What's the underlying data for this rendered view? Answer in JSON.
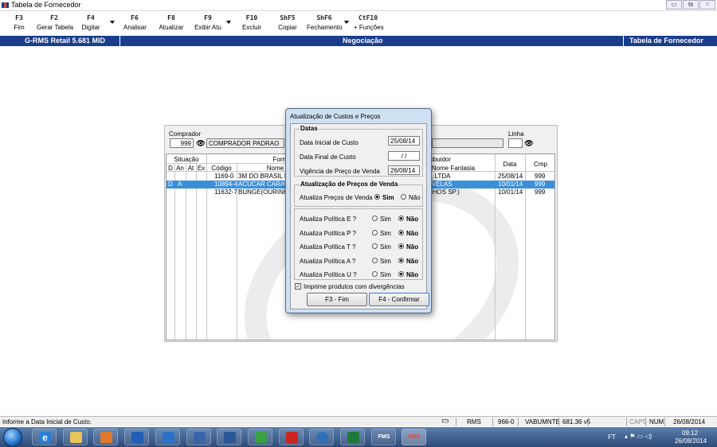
{
  "window": {
    "title": "Tabela de Fornecedor",
    "controls": [
      "▭",
      "⧉",
      "✕"
    ]
  },
  "toolbar": [
    {
      "key": "F3",
      "label": "Fim"
    },
    {
      "key": "F2",
      "label": "Gerar Tabela"
    },
    {
      "key": "F4",
      "label": "Digitar"
    },
    {
      "key": "F6",
      "label": "Analisar"
    },
    {
      "key": "F8",
      "label": "Atualizar"
    },
    {
      "key": "F9",
      "label": "Exibir Atu"
    },
    {
      "key": "F10",
      "label": "Excluir"
    },
    {
      "key": "ShF5",
      "label": "Copiar"
    },
    {
      "key": "ShF6",
      "label": "Fechamento"
    },
    {
      "key": "CtF10",
      "label": "+ Funções"
    }
  ],
  "header": {
    "left": "G-RMS Retail 5.681 MID",
    "center": "Negociação",
    "right": "Tabela de Fornecedor"
  },
  "panel": {
    "comprador_label": "Comprador",
    "comprador_code": "999",
    "comprador_name": "COMPRADOR PADRAO",
    "linha_label": "Linha",
    "cols": {
      "situacao": "Situação",
      "d": "D",
      "an": "An",
      "at": "At",
      "ex": "Ex",
      "fornecedor": "Fornecedor",
      "codigo": "Código",
      "nome": "Nome F",
      "distribuidor": "ibuidor",
      "nome_fantasia": "Nome Fantasia",
      "data": "Data",
      "cmp": "Cmp"
    },
    "rows": [
      {
        "d": "",
        "an": "",
        "codigo": "1169-0",
        "nome": "3M DO BRASIL LTDA",
        "fantasia": "IL LTDA",
        "data": "25/08/14",
        "cmp": "999",
        "selected": false
      },
      {
        "d": "D",
        "an": "A",
        "codigo": "10894-4",
        "nome": "ACUCAR CARAVELI",
        "fantasia": "AVELAS",
        "data": "10/01/14",
        "cmp": "999",
        "selected": true
      },
      {
        "d": "",
        "an": "",
        "codigo": "11632-7",
        "nome": "BUNGE(OURINHOS",
        "fantasia": "NHOS SP.)",
        "data": "10/01/14",
        "cmp": "999",
        "selected": false
      }
    ]
  },
  "dialog": {
    "title": "Atualização de Custos e Preços",
    "datas_group": "Datas",
    "data_inicial_label": "Data Inicial de Custo",
    "data_inicial_value": "25/08/14",
    "data_final_label": "Data Final de Custo",
    "data_final_value": " / /",
    "vigencia_label": "Vigência de Preço de Venda",
    "vigencia_value": "26/08/14",
    "precos_group": "Atualização de Preços de Venda",
    "atualiza_precos_label": "Atualiza Preços de Venda ?",
    "sim": "Sim",
    "nao": "Não",
    "politicas": [
      {
        "label": "Atualiza Política E ?",
        "value": "nao"
      },
      {
        "label": "Atualiza Política P ?",
        "value": "nao"
      },
      {
        "label": "Atualiza Política T ?",
        "value": "nao"
      },
      {
        "label": "Atualiza Política A ?",
        "value": "nao"
      },
      {
        "label": "Atualiza Política U ?",
        "value": "nao"
      }
    ],
    "imprime_label": "Imprime produtos com divergências",
    "imprime_checked": true,
    "btn_fim": "F3 - Fim",
    "btn_confirmar": "F4 - Confirmar"
  },
  "status": {
    "message": "Informe a Data Inicial de Custo.",
    "rms": "RMS",
    "code": "966-0",
    "user": "VABUMNTB",
    "version": "681.36 v5",
    "caps": "CAPS",
    "num": "NUM",
    "date": "26/08/2014"
  },
  "taskbar": {
    "lang": "FT",
    "time": "09:12",
    "date": "26/08/2014",
    "apps": [
      "e",
      "folder",
      "media",
      "outlook",
      "lync",
      "link",
      "word",
      "plus",
      "pdf",
      "globe",
      "excel",
      "FMS",
      "FMS"
    ]
  }
}
